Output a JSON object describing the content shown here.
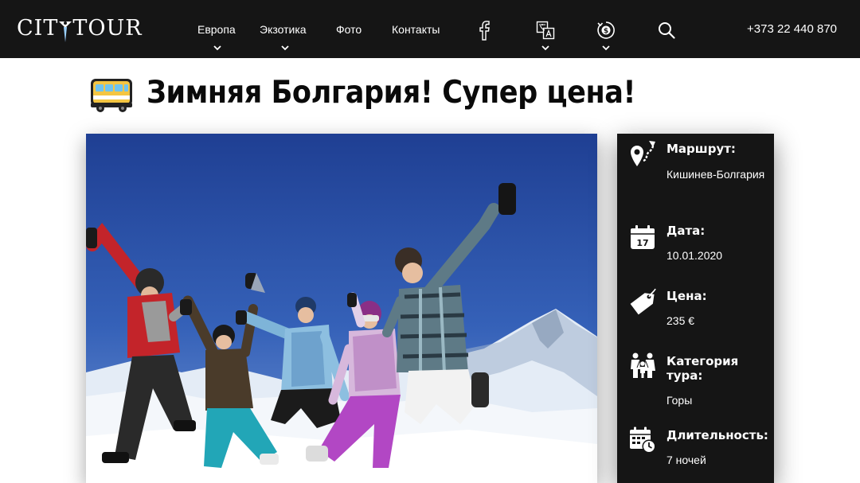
{
  "header": {
    "logo": {
      "part1": "CIT",
      "part2": "TOUR"
    },
    "nav": [
      {
        "label": "Европа",
        "has_dropdown": true
      },
      {
        "label": "Экзотика",
        "has_dropdown": true
      },
      {
        "label": "Фото",
        "has_dropdown": false
      },
      {
        "label": "Контакты",
        "has_dropdown": false
      }
    ],
    "icons": [
      "facebook-icon",
      "translate-icon",
      "currency-icon",
      "search-icon"
    ],
    "phone": "+373 22 440 870"
  },
  "title": {
    "icon": "bus-icon",
    "text": "Зимняя Болгария! Супер цена!"
  },
  "info": [
    {
      "icon": "route-icon",
      "label": "Маршрут:",
      "value": "Кишинев-Болгария"
    },
    {
      "icon": "calendar-icon",
      "label": "Дата:",
      "value": "10.01.2020",
      "icon_text": "17"
    },
    {
      "icon": "price-tag-icon",
      "label": "Цена:",
      "value": "235 €"
    },
    {
      "icon": "family-icon",
      "label": "Категория тура:",
      "value": "Горы"
    },
    {
      "icon": "calendar-clock-icon",
      "label": "Длительность:",
      "value": "7 ночей"
    }
  ],
  "colors": {
    "header_bg": "#151515",
    "panel_bg": "#151515",
    "sky": "#2f4fa0"
  }
}
